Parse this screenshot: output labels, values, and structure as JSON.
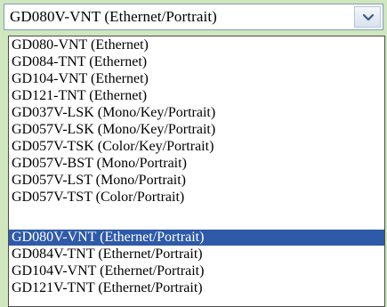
{
  "combo": {
    "value": "GD080V-VNT (Ethernet/Portrait)",
    "dropdown_button_icon": "chevron-down-icon"
  },
  "dropdown": {
    "selected_index": 11,
    "items": [
      "GD080-VNT (Ethernet)",
      "GD084-TNT (Ethernet)",
      "GD104-VNT (Ethernet)",
      "GD121-TNT (Ethernet)",
      "GD037V-LSK (Mono/Key/Portrait)",
      "GD057V-LSK (Mono/Key/Portrait)",
      "GD057V-TSK (Color/Key/Portrait)",
      "GD057V-BST (Mono/Portrait)",
      "GD057V-LST (Mono/Portrait)",
      "GD057V-TST (Color/Portrait)",
      "GD080V-VNT (Ethernet/Portrait)",
      "GD084V-TNT (Ethernet/Portrait)",
      "GD104V-VNT (Ethernet/Portrait)",
      "GD121V-TNT (Ethernet/Portrait)"
    ]
  }
}
